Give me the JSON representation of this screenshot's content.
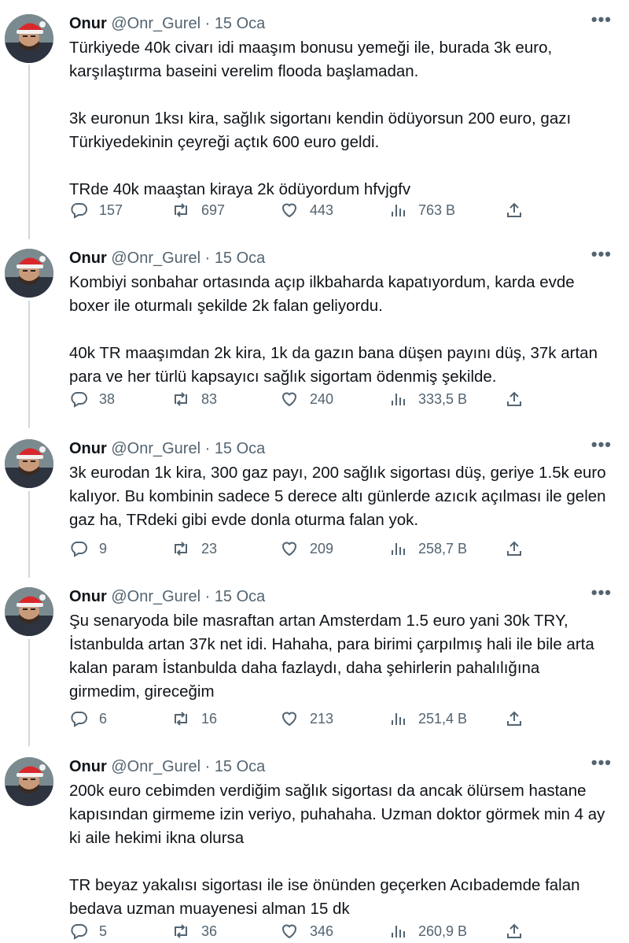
{
  "tweets": [
    {
      "name": "Onur",
      "handle": "@Onr_Gurel",
      "separator": "·",
      "date": "15 Oca",
      "more": "•••",
      "paragraphs": [
        "Türkiyede 40k civarı idi maaşım bonusu yemeği ile, burada 3k euro, karşılaştırma baseini verelim flooda başlamadan.",
        "3k euronun 1ksı kira, sağlık sigortanı kendin ödüyorsun 200 euro, gazı Türkiyedekinin çeyreği açtık 600 euro geldi.",
        "TRde 40k maaştan kiraya 2k ödüyordum hfvjgfv"
      ],
      "replies": "157",
      "retweets": "697",
      "likes": "443",
      "views": "763 B"
    },
    {
      "name": "Onur",
      "handle": "@Onr_Gurel",
      "separator": "·",
      "date": "15 Oca",
      "more": "•••",
      "paragraphs": [
        "Kombiyi sonbahar ortasında açıp ilkbaharda kapatıyordum, karda evde boxer ile oturmalı şekilde 2k falan geliyordu.",
        "40k TR maaşımdan 2k kira, 1k da gazın bana düşen payını düş, 37k artan para ve her türlü kapsayıcı sağlık sigortam ödenmiş şekilde."
      ],
      "replies": "38",
      "retweets": "83",
      "likes": "240",
      "views": "333,5 B"
    },
    {
      "name": "Onur",
      "handle": "@Onr_Gurel",
      "separator": "·",
      "date": "15 Oca",
      "more": "•••",
      "paragraphs": [
        "3k eurodan 1k kira, 300 gaz payı, 200 sağlık sigortası düş, geriye 1.5k euro kalıyor. Bu kombinin sadece 5 derece altı günlerde azıcık açılması ile gelen gaz ha, TRdeki gibi evde donla oturma falan yok."
      ],
      "replies": "9",
      "retweets": "23",
      "likes": "209",
      "views": "258,7 B"
    },
    {
      "name": "Onur",
      "handle": "@Onr_Gurel",
      "separator": "·",
      "date": "15 Oca",
      "more": "•••",
      "paragraphs": [
        "Şu senaryoda bile masraftan artan Amsterdam 1.5 euro yani 30k TRY, İstanbulda artan 37k net idi. Hahaha, para birimi çarpılmış hali ile bile arta kalan param İstanbulda daha fazlaydı, daha şehirlerin pahalılığına girmedim, gireceğim"
      ],
      "replies": "6",
      "retweets": "16",
      "likes": "213",
      "views": "251,4 B"
    },
    {
      "name": "Onur",
      "handle": "@Onr_Gurel",
      "separator": "·",
      "date": "15 Oca",
      "more": "•••",
      "paragraphs": [
        "200k euro cebimden verdiğim sağlık sigortası da ancak ölürsem hastane kapısından girmeme izin veriyo, puhahaha. Uzman doktor görmek min 4 ay ki aile hekimi ikna olursa",
        "TR beyaz yakalısı sigortası ile ise önünden geçerken Acıbademde falan bedava uzman muayenesi alman 15 dk"
      ],
      "replies": "5",
      "retweets": "36",
      "likes": "346",
      "views": "260,9 B"
    }
  ]
}
